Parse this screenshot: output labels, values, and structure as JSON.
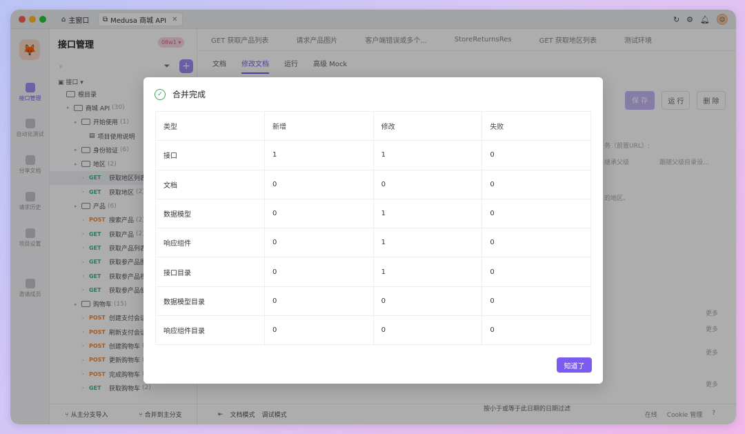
{
  "titlebar": {
    "home_tab": "主窗口",
    "active_tab": "Medusa 商城 API"
  },
  "sidebar": {
    "title": "接口管理",
    "branch": "08w1",
    "root_filter": "接口",
    "tree": [
      {
        "type": "folder",
        "label": "根目录",
        "count": "",
        "depth": 0
      },
      {
        "type": "folder",
        "label": "商城 API",
        "count": "(30)",
        "depth": 1
      },
      {
        "type": "folder",
        "label": "开始使用",
        "count": "(1)",
        "depth": 2
      },
      {
        "type": "doc",
        "label": "项目使用说明",
        "count": "",
        "depth": 3
      },
      {
        "type": "folder",
        "label": "身份验证",
        "count": "(6)",
        "depth": 2
      },
      {
        "type": "folder",
        "label": "地区",
        "count": "(2)",
        "depth": 2
      },
      {
        "type": "api",
        "method": "GET",
        "label": "获取地区列表",
        "count": "",
        "depth": 3,
        "selected": true
      },
      {
        "type": "api",
        "method": "GET",
        "label": "获取地区",
        "count": "(2)",
        "depth": 3
      },
      {
        "type": "folder",
        "label": "产品",
        "count": "(6)",
        "depth": 2
      },
      {
        "type": "api",
        "method": "POST",
        "label": "搜索产品",
        "count": "(2)",
        "depth": 3
      },
      {
        "type": "api",
        "method": "GET",
        "label": "获取产品",
        "count": "(2)",
        "depth": 3
      },
      {
        "type": "api",
        "method": "GET",
        "label": "获取产品列表",
        "count": "",
        "depth": 3
      },
      {
        "type": "api",
        "method": "GET",
        "label": "获取参产品图",
        "count": "",
        "depth": 3
      },
      {
        "type": "api",
        "method": "GET",
        "label": "获取参产品视",
        "count": "",
        "depth": 3
      },
      {
        "type": "api",
        "method": "GET",
        "label": "获取参产品使",
        "count": "",
        "depth": 3
      },
      {
        "type": "folder",
        "label": "购物车",
        "count": "(15)",
        "depth": 2
      },
      {
        "type": "api",
        "method": "POST",
        "label": "创建支付会话",
        "count": "",
        "depth": 3
      },
      {
        "type": "api",
        "method": "POST",
        "label": "刷新支付会话",
        "count": "",
        "depth": 3
      },
      {
        "type": "api",
        "method": "POST",
        "label": "创建购物车",
        "count": "(2",
        "depth": 3
      },
      {
        "type": "api",
        "method": "POST",
        "label": "更新购物车",
        "count": "(2",
        "depth": 3
      },
      {
        "type": "api",
        "method": "POST",
        "label": "完成购物车",
        "count": "(2",
        "depth": 3
      },
      {
        "type": "api",
        "method": "GET",
        "label": "获取购物车",
        "count": "(2)",
        "depth": 3
      }
    ],
    "footer_import": "从主分支导入",
    "footer_merge": "合并到主分支"
  },
  "rail": {
    "items": [
      "接口管理",
      "自动化测试",
      "分享文档",
      "请求历史",
      "项目设置",
      "邀请成员"
    ]
  },
  "main": {
    "tabs": [
      "GET 获取产品列表",
      "请求产品图片",
      "客户端错误或多个...",
      "StoreReturnsRes",
      "GET 获取地区列表"
    ],
    "env": "测试环境",
    "subtabs": [
      "文档",
      "修改文档",
      "运行",
      "高级 Mock"
    ],
    "actions": {
      "save": "保 存",
      "run": "运 行",
      "delete": "删 除"
    },
    "bg_service": "务（前置URL）:",
    "bg_inherit": "继承父级",
    "bg_inherit_hint": "跟随父级目录设...",
    "bg_desc": "的地区。",
    "bg_filter": "按小于或等于此日期的日期过滤",
    "more": "更多",
    "footer": {
      "doc_mode": "文档模式",
      "debug_mode": "调试模式",
      "online": "在线",
      "cookie": "Cookie 管理"
    }
  },
  "dialog": {
    "title": "合并完成",
    "columns": [
      "类型",
      "新增",
      "修改",
      "失败"
    ],
    "rows": [
      [
        "接口",
        "1",
        "1",
        "0"
      ],
      [
        "文档",
        "0",
        "0",
        "0"
      ],
      [
        "数据模型",
        "0",
        "1",
        "0"
      ],
      [
        "响应组件",
        "0",
        "1",
        "0"
      ],
      [
        "接口目录",
        "0",
        "1",
        "0"
      ],
      [
        "数据模型目录",
        "0",
        "0",
        "0"
      ],
      [
        "响应组件目录",
        "0",
        "0",
        "0"
      ]
    ],
    "ok_label": "知道了"
  }
}
